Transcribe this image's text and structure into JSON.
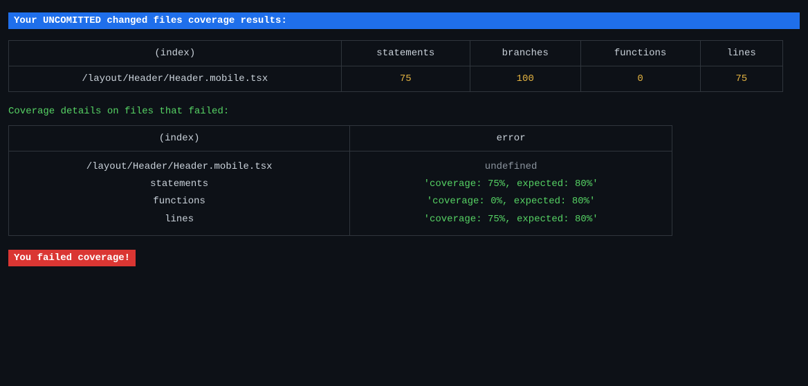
{
  "banner": {
    "uncommitted_text": "Your UNCOMITTED changed files coverage results:"
  },
  "coverage_table": {
    "headers": [
      "(index)",
      "statements",
      "branches",
      "functions",
      "lines"
    ],
    "rows": [
      {
        "file": "/layout/Header/Header.mobile.tsx",
        "statements": "75",
        "branches": "100",
        "functions": "0",
        "lines": "75"
      }
    ]
  },
  "failed_section": {
    "title": "Coverage details on files that failed:",
    "headers": [
      "(index)",
      "error"
    ],
    "rows": [
      {
        "file_lines": [
          "/layout/Header/Header.mobile.tsx",
          "statements",
          "functions",
          "lines"
        ],
        "error_lines": [
          {
            "text": "undefined",
            "color": "gray"
          },
          {
            "text": "'coverage: 75%, expected: 80%'",
            "color": "green"
          },
          {
            "text": "'coverage: 0%, expected: 80%'",
            "color": "green"
          },
          {
            "text": "'coverage: 75%, expected: 80%'",
            "color": "green"
          }
        ]
      }
    ]
  },
  "failed_banner": {
    "text": "You failed coverage!"
  }
}
